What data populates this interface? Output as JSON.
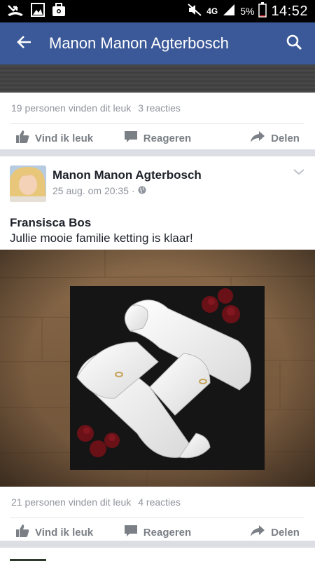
{
  "status_bar": {
    "network": "4G",
    "battery": "5%",
    "time": "14:52",
    "icons": [
      "missed-call-icon",
      "image-icon",
      "briefcase-icon",
      "mute-icon",
      "signal-icon",
      "battery-icon"
    ]
  },
  "app_bar": {
    "title": "Manon Manon Agterbosch",
    "icons": [
      "back-arrow-icon",
      "search-icon"
    ],
    "color": "#3b5998"
  },
  "post1": {
    "likes": "19 personen vinden dit leuk",
    "comments": "3 reacties"
  },
  "actions": {
    "like": "Vind ik leuk",
    "comment": "Reageren",
    "share": "Delen"
  },
  "post2": {
    "author": "Manon Manon Agterbosch",
    "date": "25 aug. om 20:35 ·",
    "tagged": "Fransisca Bos",
    "message": "Jullie mooie familie ketting is klaar!",
    "likes": "21 personen vinden dit leuk",
    "comments": "4 reacties"
  }
}
